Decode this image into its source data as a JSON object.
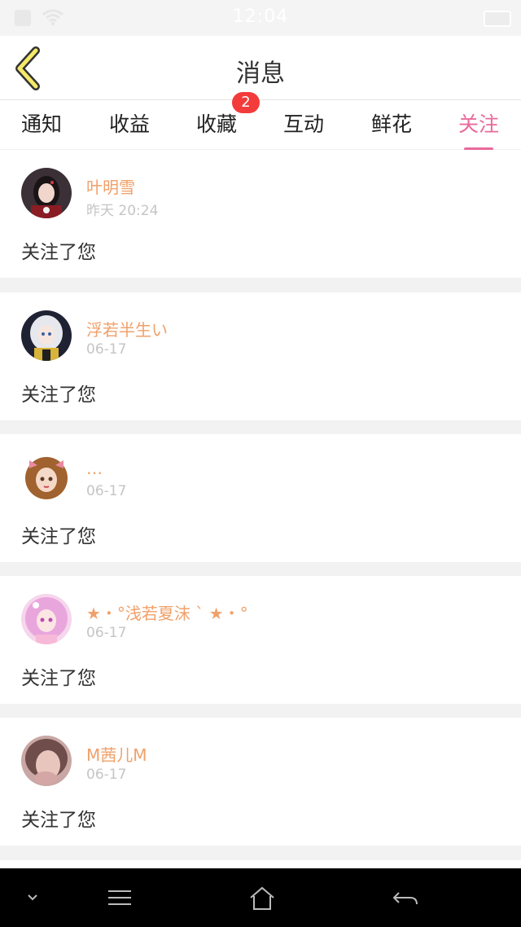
{
  "status_bar": {
    "time": "12:04"
  },
  "header": {
    "title": "消息"
  },
  "tabs": [
    {
      "label": "通知"
    },
    {
      "label": "收益"
    },
    {
      "label": "收藏",
      "badge": "2"
    },
    {
      "label": "互动"
    },
    {
      "label": "鲜花"
    },
    {
      "label": "关注",
      "active": true
    }
  ],
  "items": [
    {
      "name": "叶明雪",
      "time": "昨天 20:24",
      "message": "关注了您"
    },
    {
      "name": "浮若半生い",
      "time": "06-17",
      "message": "关注了您"
    },
    {
      "name": "…",
      "time": "06-17",
      "message": "关注了您"
    },
    {
      "name": "★・°浅若夏沫 ˋ ★・°",
      "time": "06-17",
      "message": "关注了您"
    },
    {
      "name": "M茜儿M",
      "time": "06-17",
      "message": "关注了您"
    }
  ],
  "colors": {
    "accent": "#e96a9b",
    "name": "#f0a06a",
    "badge": "#f33b3b",
    "back_icon": "#f5e96a"
  }
}
